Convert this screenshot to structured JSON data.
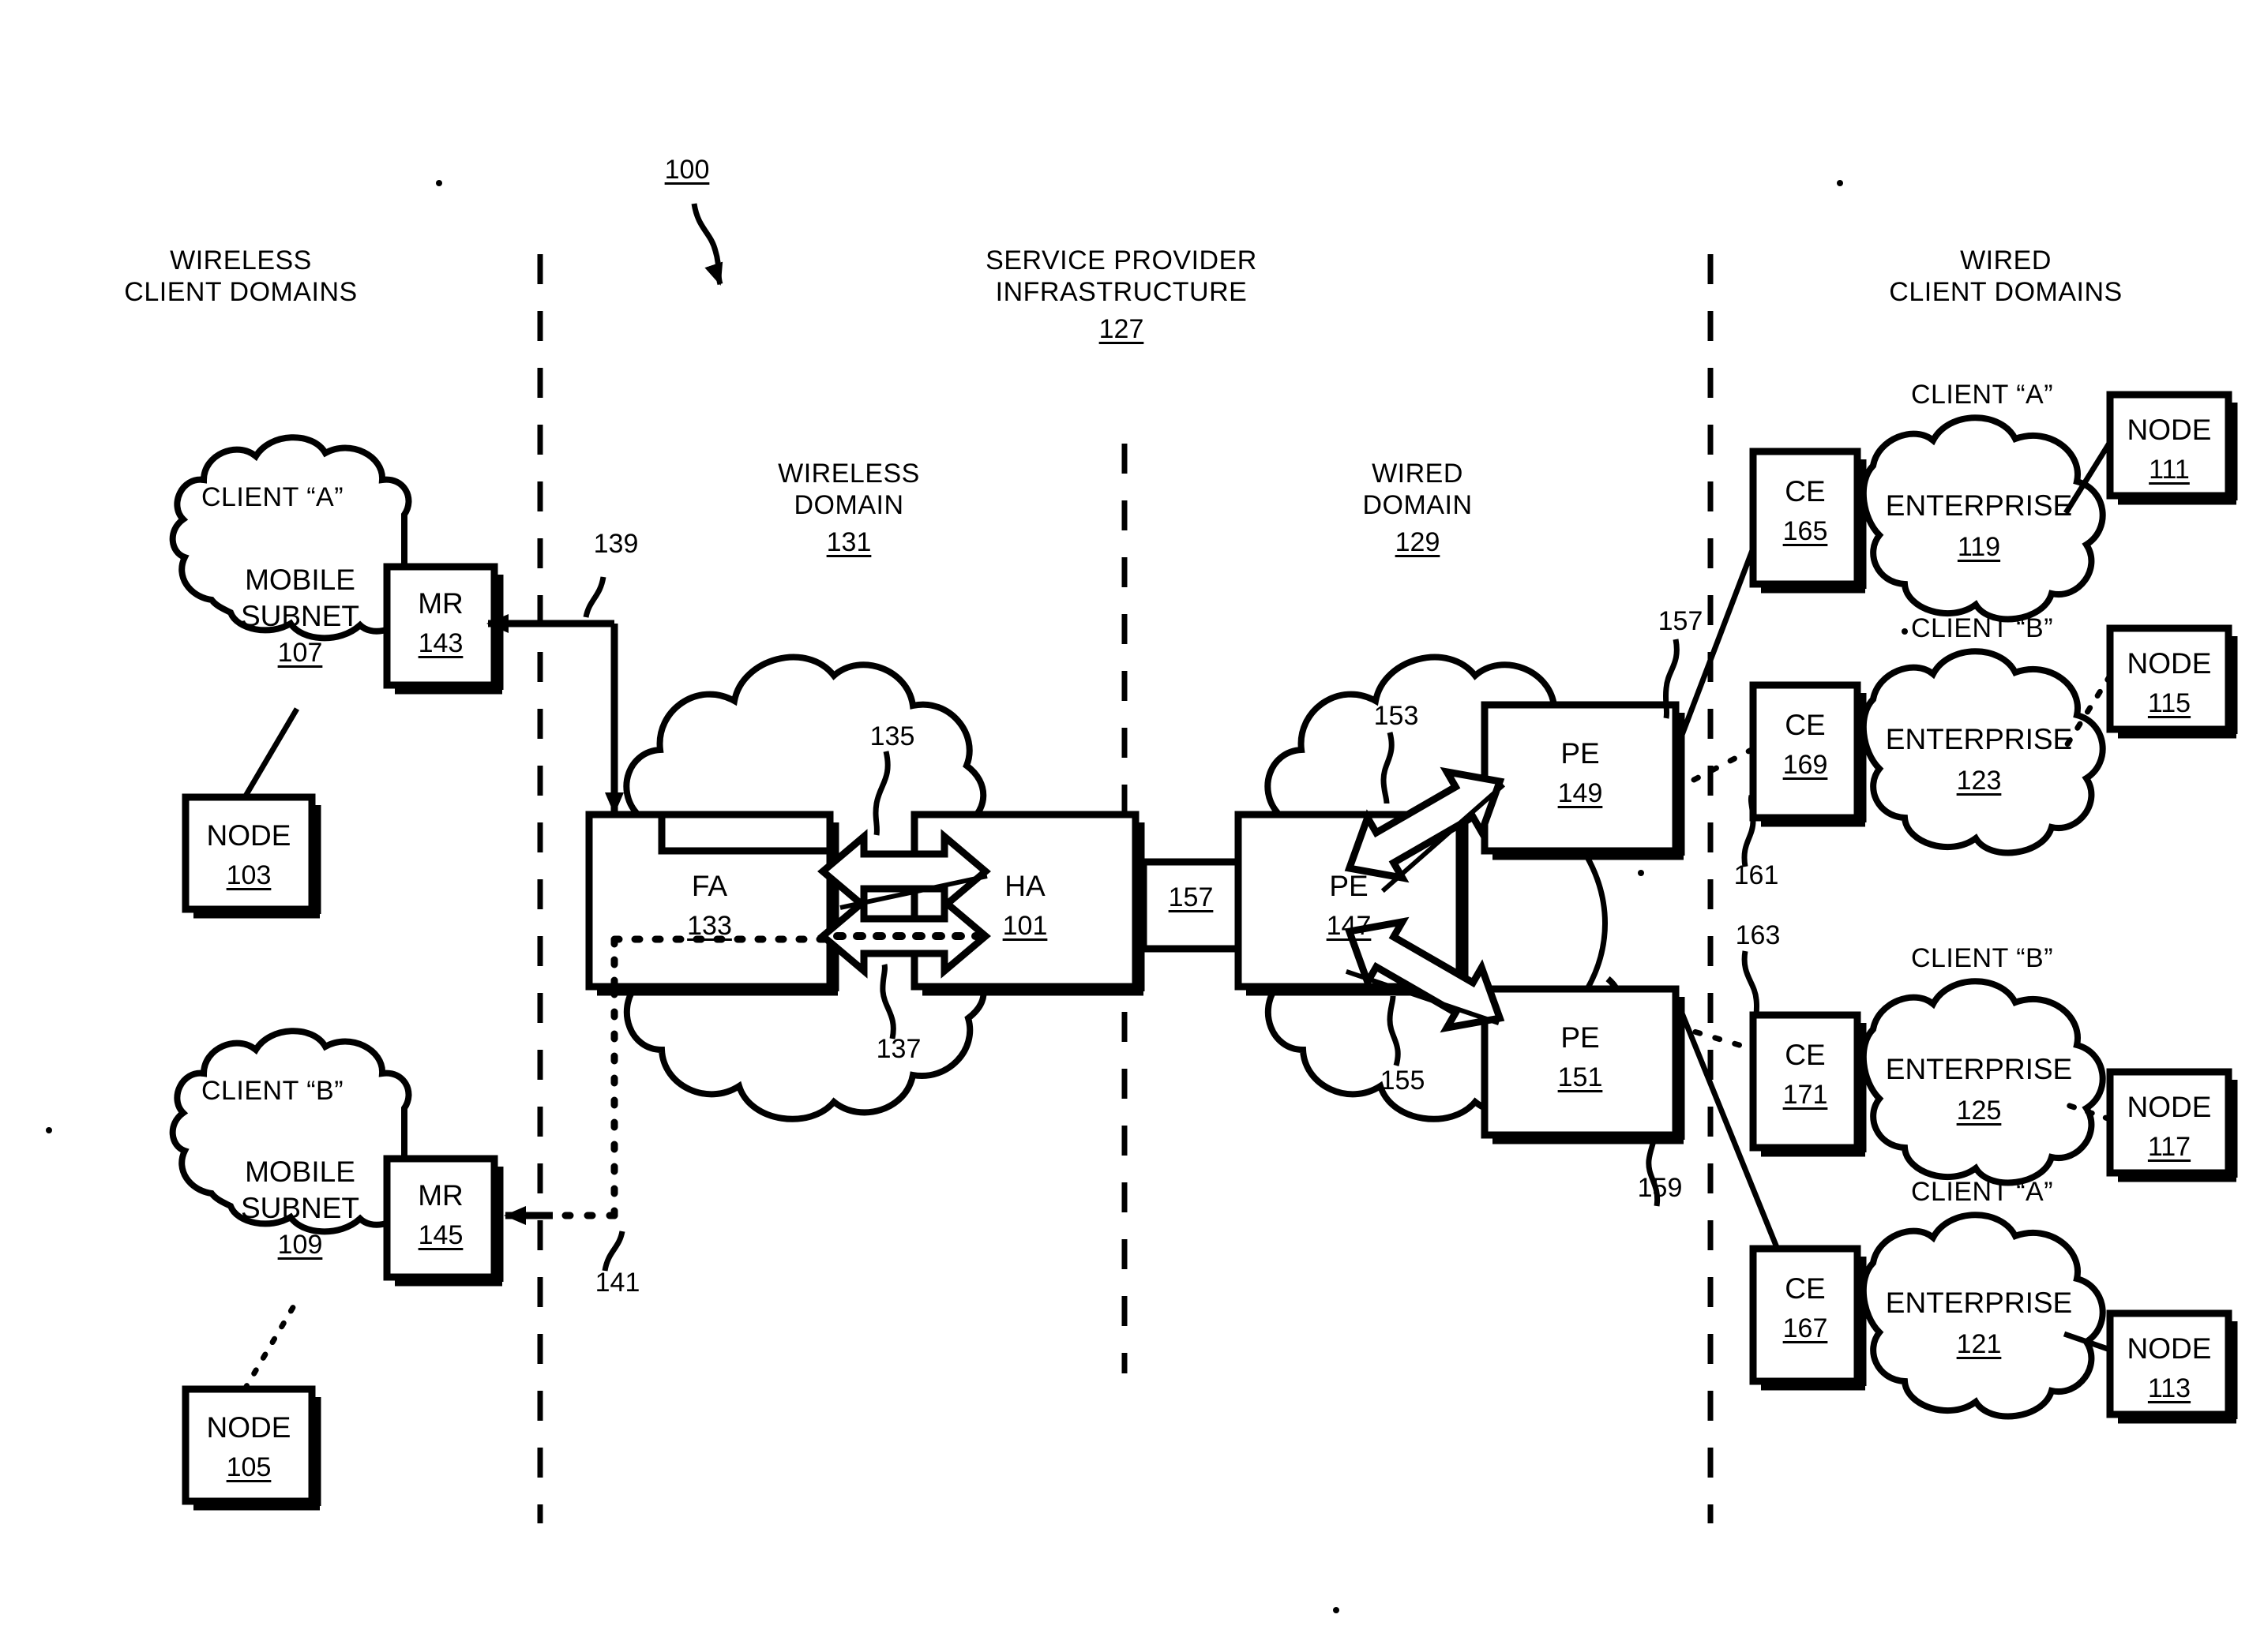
{
  "figure": {
    "id": "100",
    "type": "patent-network-diagram"
  },
  "column_headers": {
    "left": "WIRELESS\nCLIENT DOMAINS",
    "center": "SERVICE PROVIDER\nINFRASTRUCTURE",
    "center_ref": "127",
    "right": "WIRED\nCLIENT DOMAINS"
  },
  "domains": {
    "wireless": {
      "label": "WIRELESS\nDOMAIN",
      "ref": "131"
    },
    "wired": {
      "label": "WIRED\nDOMAIN",
      "ref": "129"
    }
  },
  "wireless_clients": [
    {
      "client_label": "CLIENT “A”",
      "cloud_label": "MOBILE\nSUBNET",
      "cloud_ref": "107",
      "router_label": "MR",
      "router_ref": "143",
      "node_label": "NODE",
      "node_ref": "103"
    },
    {
      "client_label": "CLIENT “B”",
      "cloud_label": "MOBILE\nSUBNET",
      "cloud_ref": "109",
      "router_label": "MR",
      "router_ref": "145",
      "node_label": "NODE",
      "node_ref": "105"
    }
  ],
  "core_nodes": {
    "fa": {
      "label": "FA",
      "ref": "133"
    },
    "ha": {
      "label": "HA",
      "ref": "101"
    },
    "pe_center": {
      "label": "PE",
      "ref": "147"
    },
    "pe_upper": {
      "label": "PE",
      "ref": "149"
    },
    "pe_lower": {
      "label": "PE",
      "ref": "151"
    },
    "link_center": {
      "ref": "157"
    }
  },
  "wired_clients": [
    {
      "client_label": "CLIENT “A”",
      "ce_label": "CE",
      "ce_ref": "165",
      "cloud_label": "ENTERPRISE",
      "cloud_ref": "119",
      "node_label": "NODE",
      "node_ref": "111"
    },
    {
      "client_label": "CLIENT “B”",
      "ce_label": "CE",
      "ce_ref": "169",
      "cloud_label": "ENTERPRISE",
      "cloud_ref": "123",
      "node_label": "NODE",
      "node_ref": "115"
    },
    {
      "client_label": "CLIENT “B”",
      "ce_label": "CE",
      "ce_ref": "171",
      "cloud_label": "ENTERPRISE",
      "cloud_ref": "125",
      "node_label": "NODE",
      "node_ref": "117"
    },
    {
      "client_label": "CLIENT “A”",
      "ce_label": "CE",
      "ce_ref": "167",
      "cloud_label": "ENTERPRISE",
      "cloud_ref": "121",
      "node_label": "NODE",
      "node_ref": "113"
    }
  ],
  "callouts": {
    "c139": "139",
    "c141": "141",
    "c135": "135",
    "c137": "137",
    "c153": "153",
    "c155": "155",
    "c157_right": "157",
    "c159": "159",
    "c161": "161",
    "c163": "163"
  },
  "colors": {
    "ink": "#000000",
    "paper": "#ffffff"
  }
}
